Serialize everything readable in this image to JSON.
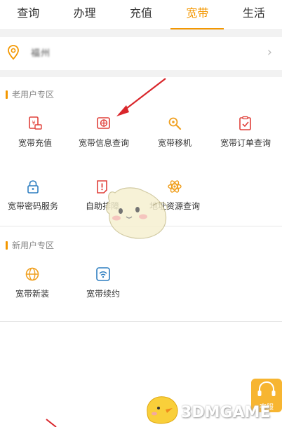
{
  "tabs": [
    {
      "label": "查询",
      "active": false
    },
    {
      "label": "办理",
      "active": false
    },
    {
      "label": "充值",
      "active": false
    },
    {
      "label": "宽带",
      "active": true
    },
    {
      "label": "生活",
      "active": false
    }
  ],
  "location": {
    "text": "福州",
    "icon": "location-pin-icon"
  },
  "old_user": {
    "title": "老用户专区",
    "items": [
      {
        "label": "宽带充值",
        "icon": "broadband-recharge-icon"
      },
      {
        "label": "宽带信息查询",
        "icon": "broadband-info-query-icon"
      },
      {
        "label": "宽带移机",
        "icon": "broadband-relocate-icon"
      },
      {
        "label": "宽带订单查询",
        "icon": "broadband-order-query-icon"
      },
      {
        "label": "宽带密码服务",
        "icon": "broadband-password-icon"
      },
      {
        "label": "自助排障",
        "icon": "self-troubleshoot-icon"
      },
      {
        "label": "地址资源查询",
        "icon": "address-resource-query-icon"
      }
    ]
  },
  "new_user": {
    "title": "新用户专区",
    "items": [
      {
        "label": "宽带新装",
        "icon": "broadband-new-install-icon"
      },
      {
        "label": "宽带续约",
        "icon": "broadband-renew-icon"
      }
    ]
  },
  "support_button": {
    "label": "客服",
    "icon": "headset-icon"
  },
  "watermark": {
    "text": "3DMGAME"
  },
  "colors": {
    "accent": "#f39700",
    "icon_red": "#e0403a",
    "icon_blue": "#2f7fc1",
    "icon_orange": "#f0a020"
  }
}
